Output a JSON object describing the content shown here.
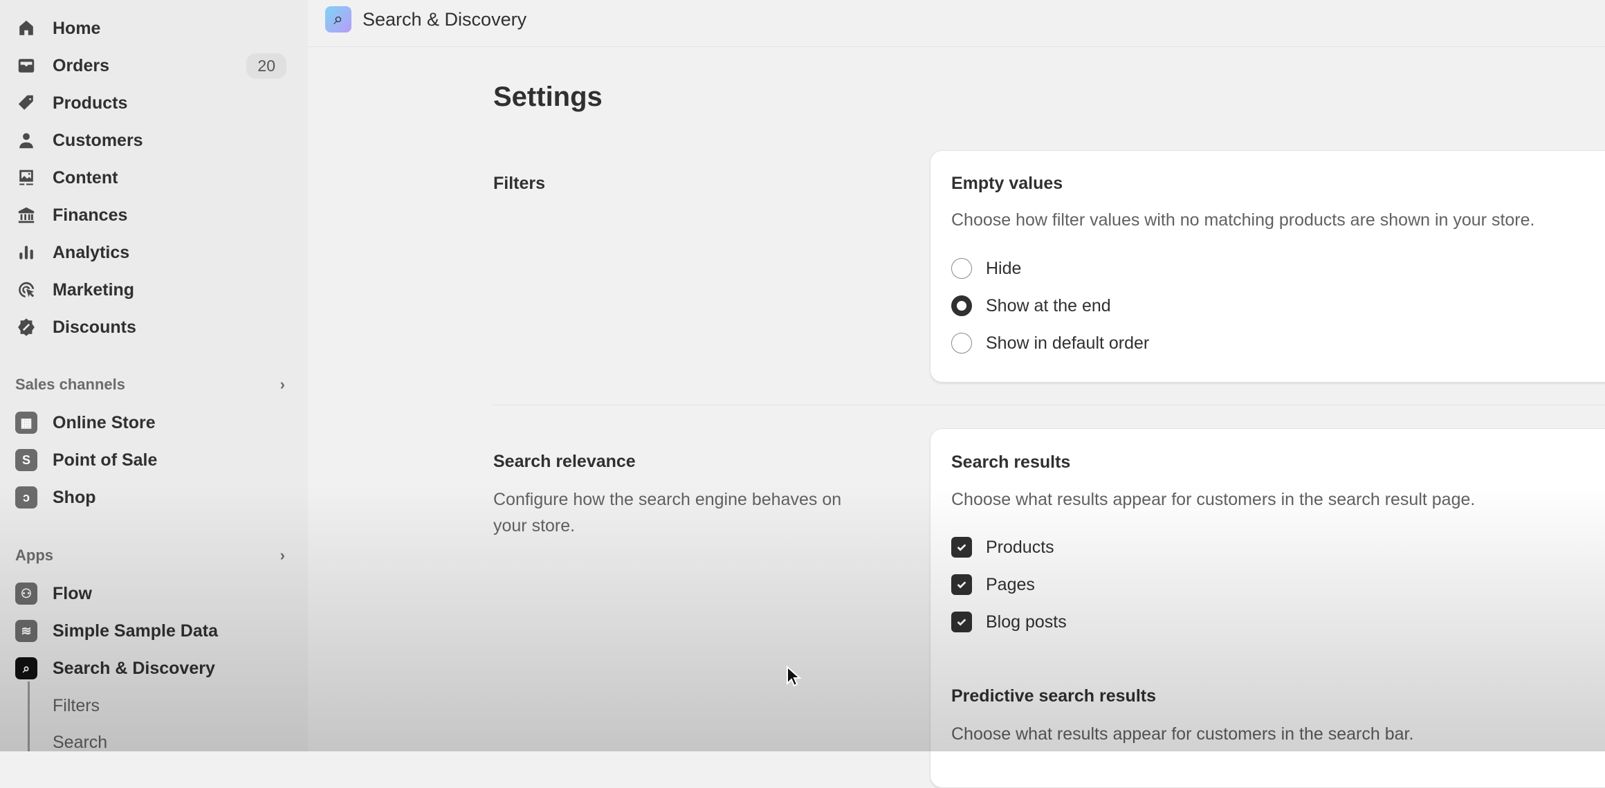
{
  "sidebar": {
    "main": [
      {
        "label": "Home",
        "icon": "home-icon"
      },
      {
        "label": "Orders",
        "icon": "inbox-icon",
        "badge": "20"
      },
      {
        "label": "Products",
        "icon": "tag-icon"
      },
      {
        "label": "Customers",
        "icon": "person-icon"
      },
      {
        "label": "Content",
        "icon": "image-icon"
      },
      {
        "label": "Finances",
        "icon": "bank-icon"
      },
      {
        "label": "Analytics",
        "icon": "bar-chart-icon"
      },
      {
        "label": "Marketing",
        "icon": "target-icon"
      },
      {
        "label": "Discounts",
        "icon": "discount-icon"
      }
    ],
    "sales_channels": {
      "title": "Sales channels",
      "items": [
        {
          "label": "Online Store"
        },
        {
          "label": "Point of Sale"
        },
        {
          "label": "Shop"
        }
      ]
    },
    "apps": {
      "title": "Apps",
      "items": [
        {
          "label": "Flow"
        },
        {
          "label": "Simple Sample Data"
        },
        {
          "label": "Search & Discovery"
        }
      ],
      "sub": [
        {
          "label": "Filters"
        },
        {
          "label": "Search"
        }
      ]
    }
  },
  "header": {
    "title": "Search & Discovery"
  },
  "page": {
    "title": "Settings"
  },
  "filters": {
    "title": "Filters",
    "card_title": "Empty values",
    "card_desc": "Choose how filter values with no matching products are shown in your store.",
    "options": [
      {
        "label": "Hide",
        "selected": false
      },
      {
        "label": "Show at the end",
        "selected": true
      },
      {
        "label": "Show in default order",
        "selected": false
      }
    ]
  },
  "search_relevance": {
    "title": "Search relevance",
    "desc_line1": "Configure how the search engine behaves on",
    "desc_line2": "your store.",
    "results_title": "Search results",
    "results_desc": "Choose what results appear for customers in the search result page.",
    "checks": [
      {
        "label": "Products",
        "checked": true
      },
      {
        "label": "Pages",
        "checked": true
      },
      {
        "label": "Blog posts",
        "checked": true
      }
    ],
    "predictive_title": "Predictive search results",
    "predictive_desc": "Choose what results appear for customers in the search bar."
  }
}
